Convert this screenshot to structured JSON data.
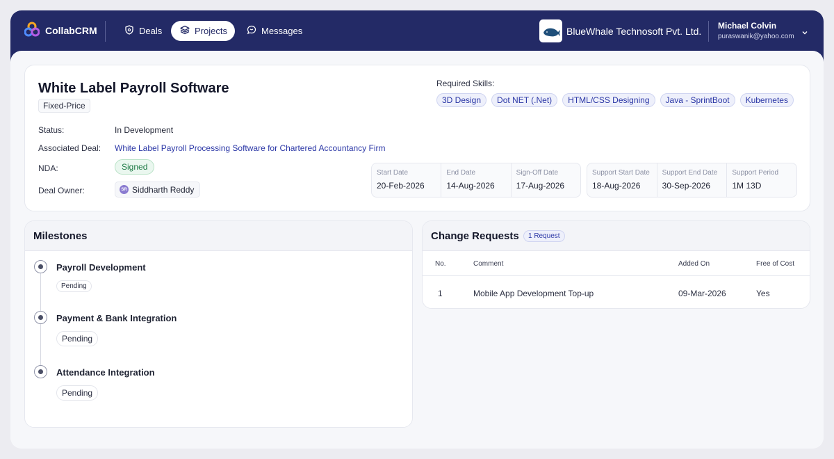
{
  "brand": {
    "name": "CollabCRM"
  },
  "nav": [
    {
      "label": "Deals",
      "active": false
    },
    {
      "label": "Projects",
      "active": true
    },
    {
      "label": "Messages",
      "active": false
    }
  ],
  "company": {
    "name": "BlueWhale Technosoft Pvt. Ltd."
  },
  "user": {
    "name": "Michael Colvin",
    "email": "puraswanik@yahoo.com"
  },
  "project": {
    "title": "White Label Payroll Software",
    "pricing": "Fixed-Price",
    "status_label": "Status:",
    "status": "In Development",
    "deal_label": "Associated Deal:",
    "deal": "White Label Payroll Processing Software for Chartered Accountancy Firm",
    "nda_label": "NDA:",
    "nda": "Signed",
    "owner_label": "Deal Owner:",
    "owner": "Siddharth Reddy",
    "owner_initials": "SR",
    "skills_label": "Required Skills:",
    "skills": [
      "3D Design",
      "Dot NET (.Net)",
      "HTML/CSS Designing",
      "Java - SprintBoot",
      "Kubernetes"
    ],
    "dates": [
      {
        "label": "Start Date",
        "value": "20-Feb-2026"
      },
      {
        "label": "End Date",
        "value": "14-Aug-2026"
      },
      {
        "label": "Sign-Off Date",
        "value": "17-Aug-2026"
      }
    ],
    "support": [
      {
        "label": "Support Start Date",
        "value": "18-Aug-2026"
      },
      {
        "label": "Support End Date",
        "value": "30-Sep-2026"
      },
      {
        "label": "Support Period",
        "value": "1M 13D"
      }
    ]
  },
  "milestones": {
    "title": "Milestones",
    "items": [
      {
        "title": "Payroll Development",
        "status": "Pending"
      },
      {
        "title": "Payment & Bank Integration",
        "status": "Pending"
      },
      {
        "title": "Attendance Integration",
        "status": "Pending"
      }
    ]
  },
  "change_requests": {
    "title": "Change Requests",
    "count": "1 Request",
    "columns": [
      "No.",
      "Comment",
      "Added On",
      "Free of Cost"
    ],
    "rows": [
      [
        "1",
        "Mobile App Development Top-up",
        "09-Mar-2026",
        "Yes"
      ]
    ]
  },
  "colors": {
    "nav_bg": "#232a66",
    "link": "#2b37a6",
    "success": "#1e7a45"
  }
}
